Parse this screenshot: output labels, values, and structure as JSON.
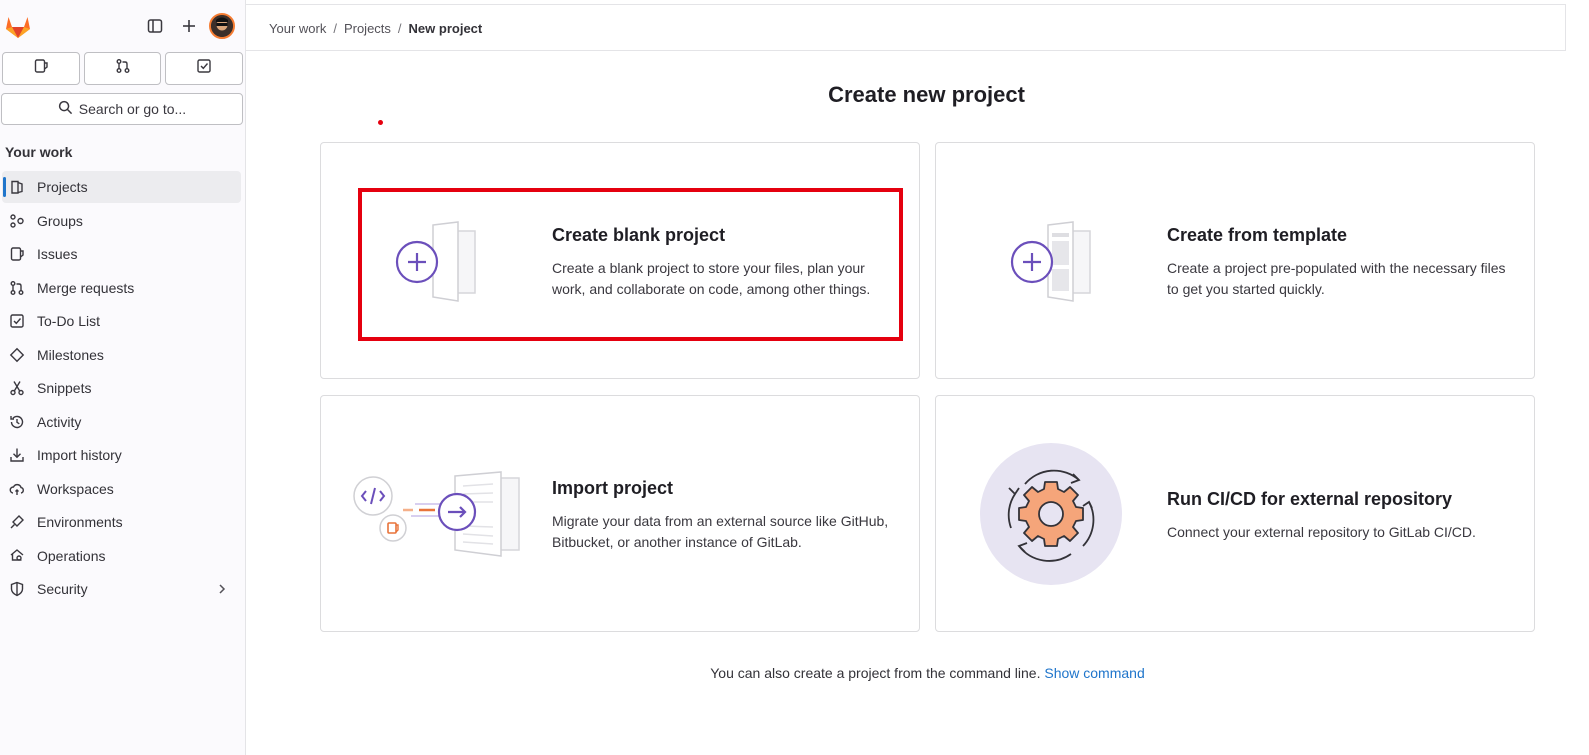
{
  "sidebar": {
    "section_title": "Your work",
    "search_label": "Search or go to...",
    "items": [
      {
        "label": "Projects",
        "icon": "project-icon",
        "active": true
      },
      {
        "label": "Groups",
        "icon": "group-icon"
      },
      {
        "label": "Issues",
        "icon": "issues-icon"
      },
      {
        "label": "Merge requests",
        "icon": "merge-request-icon"
      },
      {
        "label": "To-Do List",
        "icon": "todo-icon"
      },
      {
        "label": "Milestones",
        "icon": "milestone-icon"
      },
      {
        "label": "Snippets",
        "icon": "snippet-icon"
      },
      {
        "label": "Activity",
        "icon": "history-icon"
      },
      {
        "label": "Import history",
        "icon": "import-icon"
      },
      {
        "label": "Workspaces",
        "icon": "workspace-icon"
      },
      {
        "label": "Environments",
        "icon": "environment-icon"
      },
      {
        "label": "Operations",
        "icon": "operations-icon"
      },
      {
        "label": "Security",
        "icon": "shield-icon",
        "has_chevron": true
      }
    ]
  },
  "breadcrumb": {
    "items": [
      "Your work",
      "Projects"
    ],
    "current": "New project"
  },
  "main": {
    "title": "Create new project",
    "cards": [
      {
        "title": "Create blank project",
        "desc": "Create a blank project to store your files, plan your work, and collaborate on code, among other things.",
        "icon": "blank-project-illustration"
      },
      {
        "title": "Create from template",
        "desc": "Create a project pre-populated with the necessary files to get you started quickly.",
        "icon": "template-project-illustration"
      },
      {
        "title": "Import project",
        "desc": "Migrate your data from an external source like GitHub, Bitbucket, or another instance of GitLab.",
        "icon": "import-project-illustration"
      },
      {
        "title": "Run CI/CD for external repository",
        "desc": "Connect your external repository to GitLab CI/CD.",
        "icon": "cicd-gear-illustration"
      }
    ],
    "footer_text": "You can also create a project from the command line.",
    "footer_link": "Show command"
  },
  "colors": {
    "accent_purple": "#6b4fbb",
    "link_blue": "#1f75cb",
    "highlight_red": "#e5000f",
    "active_indicator": "#1f75cb"
  }
}
